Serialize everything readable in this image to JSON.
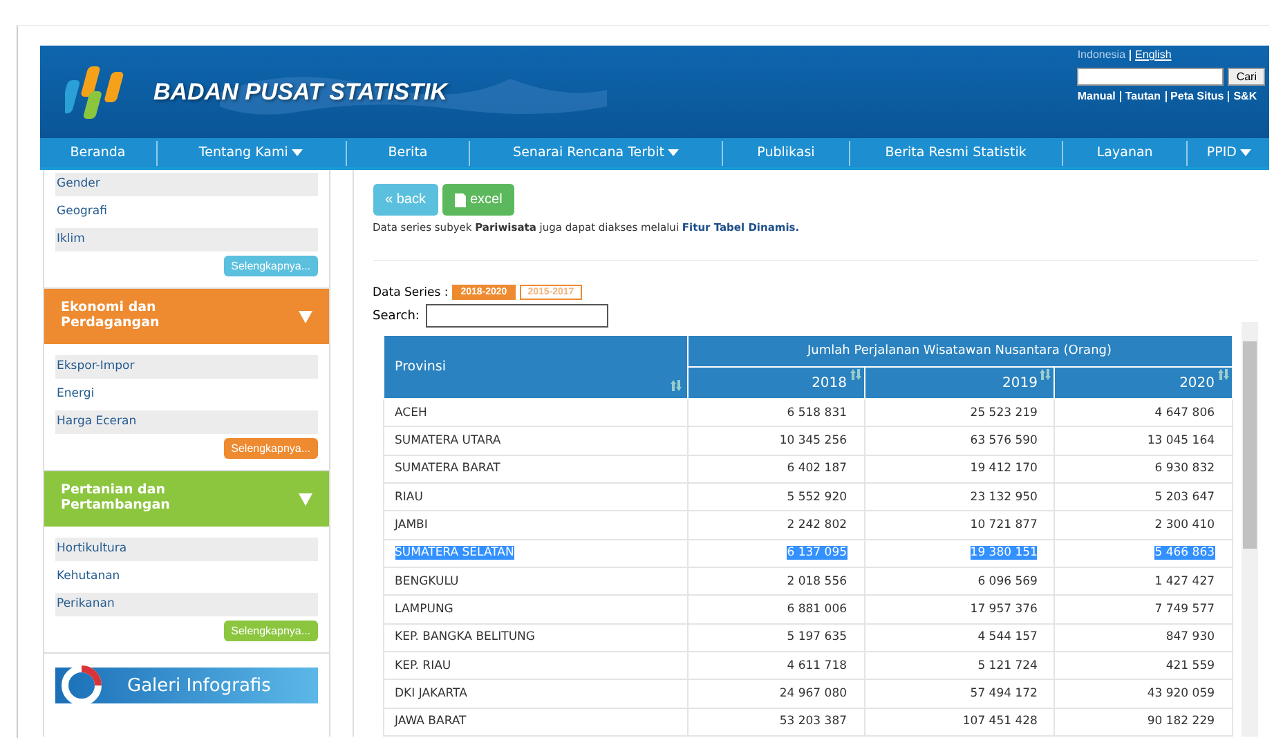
{
  "header": {
    "site_title": "BADAN PUSAT STATISTIK",
    "languages": [
      {
        "label": "Indonesia",
        "selected": true
      },
      {
        "label": "English",
        "selected": false
      }
    ],
    "search_button": "Cari",
    "links": [
      "Manual",
      "Tautan",
      "Peta Situs",
      "S&K"
    ]
  },
  "nav": [
    {
      "label": "Beranda",
      "dropdown": false
    },
    {
      "label": "Tentang Kami",
      "dropdown": true
    },
    {
      "label": "Berita",
      "dropdown": false
    },
    {
      "label": "Senarai Rencana Terbit",
      "dropdown": true
    },
    {
      "label": "Publikasi",
      "dropdown": false
    },
    {
      "label": "Berita Resmi Statistik",
      "dropdown": false
    },
    {
      "label": "Layanan",
      "dropdown": false
    },
    {
      "label": "PPID",
      "dropdown": true
    }
  ],
  "sidebar": {
    "sections": [
      {
        "color": "#5bc0de",
        "items": [
          "Gender",
          "Geografi",
          "Iklim"
        ],
        "more": "Selengkapnya..."
      },
      {
        "title": "Ekonomi dan Perdagangan",
        "color": "#ee8a2f",
        "items": [
          "Ekspor-Impor",
          "Energi",
          "Harga Eceran"
        ],
        "more": "Selengkapnya..."
      },
      {
        "title": "Pertanian dan Pertambangan",
        "color": "#8cc63f",
        "items": [
          "Hortikultura",
          "Kehutanan",
          "Perikanan"
        ],
        "more": "Selengkapnya..."
      }
    ],
    "gallery": "Galeri Infografis"
  },
  "actions": [
    {
      "label": "« back",
      "kind": "back"
    },
    {
      "label": "excel",
      "kind": "excel"
    }
  ],
  "note": {
    "text": "Data series subyek **Pariwisata** juga dapat diakses melalui",
    "link": "Fitur Tabel Dinamis."
  },
  "series": {
    "label": "Data Series :",
    "options": [
      {
        "label": "2018-2020",
        "selected": true
      },
      {
        "label": "2015-2017",
        "selected": false
      }
    ]
  },
  "search": {
    "label": "Search:"
  },
  "table": {
    "row_header": "Provinsi",
    "group_header": "Jumlah Perjalanan Wisatawan Nusantara (Orang)",
    "columns": [
      "2018",
      "2019",
      "2020"
    ],
    "rows": [
      {
        "province": "ACEH",
        "values": [
          "6 518 831",
          "25 523 219",
          "4 647 806"
        ],
        "selected": false
      },
      {
        "province": "SUMATERA UTARA",
        "values": [
          "10 345 256",
          "63 576 590",
          "13 045 164"
        ],
        "selected": false
      },
      {
        "province": "SUMATERA BARAT",
        "values": [
          "6 402 187",
          "19 412 170",
          "6 930 832"
        ],
        "selected": false
      },
      {
        "province": "RIAU",
        "values": [
          "5 552 920",
          "23 132 950",
          "5 203 647"
        ],
        "selected": false
      },
      {
        "province": "JAMBI",
        "values": [
          "2 242 802",
          "10 721 877",
          "2 300 410"
        ],
        "selected": false
      },
      {
        "province": "SUMATERA SELATAN",
        "values": [
          "6 137 095",
          "19 380 151",
          "5 466 863"
        ],
        "selected": true
      },
      {
        "province": "BENGKULU",
        "values": [
          "2 018 556",
          "6 096 569",
          "1 427 427"
        ],
        "selected": false
      },
      {
        "province": "LAMPUNG",
        "values": [
          "6 881 006",
          "17 957 376",
          "7 749 577"
        ],
        "selected": false
      },
      {
        "province": "KEP. BANGKA BELITUNG",
        "values": [
          "5 197 635",
          "4 544 157",
          "847 930"
        ],
        "selected": false
      },
      {
        "province": "KEP. RIAU",
        "values": [
          "4 611 718",
          "5 121 724",
          "421 559"
        ],
        "selected": false
      },
      {
        "province": "DKI JAKARTA",
        "values": [
          "24 967 080",
          "57 494 172",
          "43 920 059"
        ],
        "selected": false
      },
      {
        "province": "JAWA BARAT",
        "values": [
          "53 203 387",
          "107 451 428",
          "90 182 229"
        ],
        "selected": false
      }
    ]
  }
}
